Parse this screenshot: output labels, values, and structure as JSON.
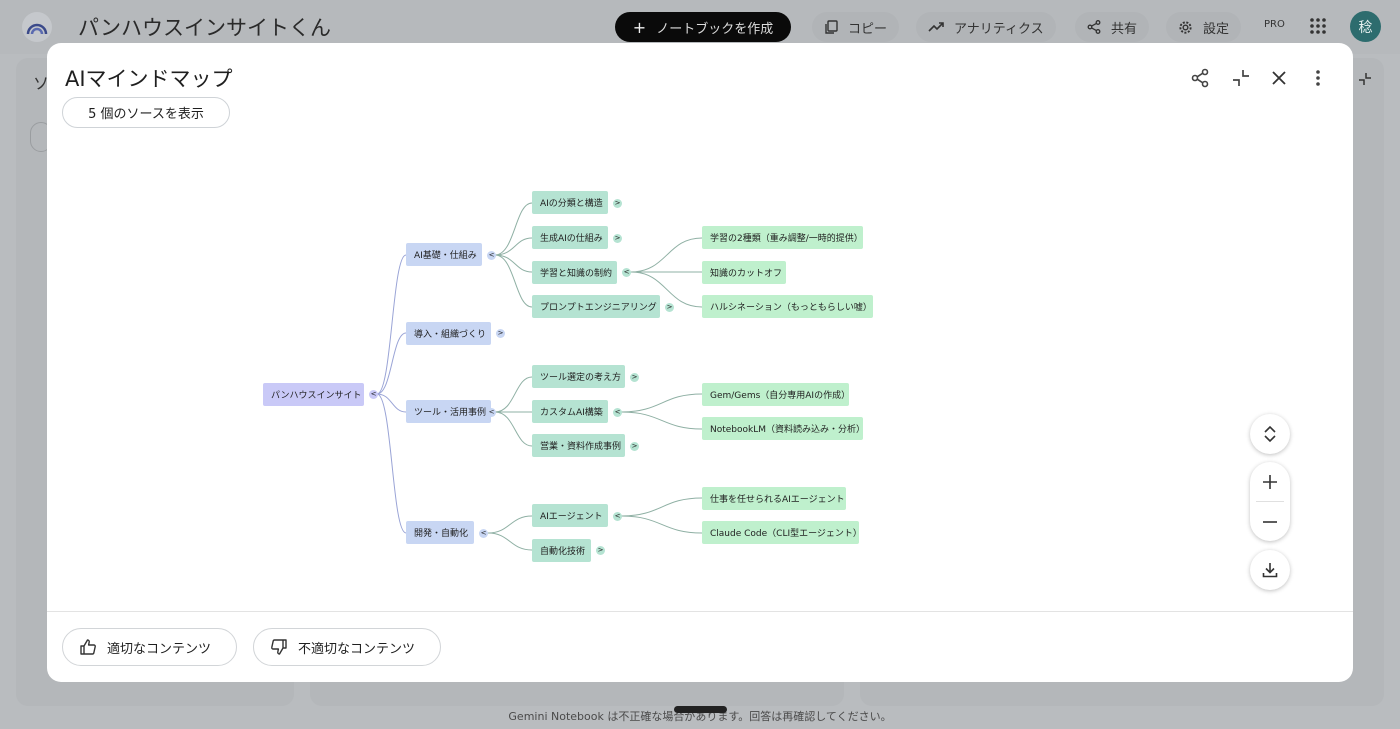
{
  "app": {
    "title": "パンハウスインサイトくん",
    "create_notebook": "ノートブックを作成",
    "copy": "コピー",
    "analytics": "アナリティクス",
    "share": "共有",
    "settings": "設定",
    "pro": "PRO",
    "avatar_initial": "稔",
    "side_letter": "ソ",
    "disclaimer": "Gemini Notebook は不正確な場合があります。回答は再確認してください。"
  },
  "modal": {
    "title": "AIマインドマップ",
    "sources_button": "5 個のソースを表示",
    "icons": [
      "share-icon",
      "collapse-icon",
      "close-icon",
      "more-vert-icon"
    ],
    "feedback_good": "適切なコンテンツ",
    "feedback_bad": "不適切なコンテンツ"
  },
  "mindmap": {
    "root": "パンハウスインサイト",
    "branches": [
      {
        "label": "AI基礎・仕組み",
        "children": [
          {
            "label": "AIの分類と構造",
            "children": []
          },
          {
            "label": "生成AIの仕組み",
            "children": []
          },
          {
            "label": "学習と知識の制約",
            "children": [
              "学習の2種類（重み調整/一時的提供）",
              "知識のカットオフ",
              "ハルシネーション（もっともらしい嘘）"
            ]
          },
          {
            "label": "プロンプトエンジニアリング",
            "children": []
          }
        ]
      },
      {
        "label": "導入・組織づくり",
        "children": []
      },
      {
        "label": "ツール・活用事例",
        "children": [
          {
            "label": "ツール選定の考え方",
            "children": []
          },
          {
            "label": "カスタムAI構築",
            "children": [
              "Gem/Gems（自分専用AIの作成）",
              "NotebookLM（資料読み込み・分析）"
            ]
          },
          {
            "label": "営業・資料作成事例",
            "children": []
          }
        ]
      },
      {
        "label": "開発・自動化",
        "children": [
          {
            "label": "AIエージェント",
            "children": [
              "仕事を任せられるAIエージェント",
              "Claude Code（CLI型エージェント）"
            ]
          },
          {
            "label": "自動化技術",
            "children": []
          }
        ]
      }
    ],
    "expand_glyph": ">",
    "collapse_glyph": "<"
  },
  "colors": {
    "root_node": "#c9c9f7",
    "level1_node": "#c8d6f3",
    "level2_node": "#b5e3d2",
    "level3_node": "#bff0cd",
    "edge_level1": "#9aa4d6",
    "edge_level2": "#8fb0a4"
  }
}
